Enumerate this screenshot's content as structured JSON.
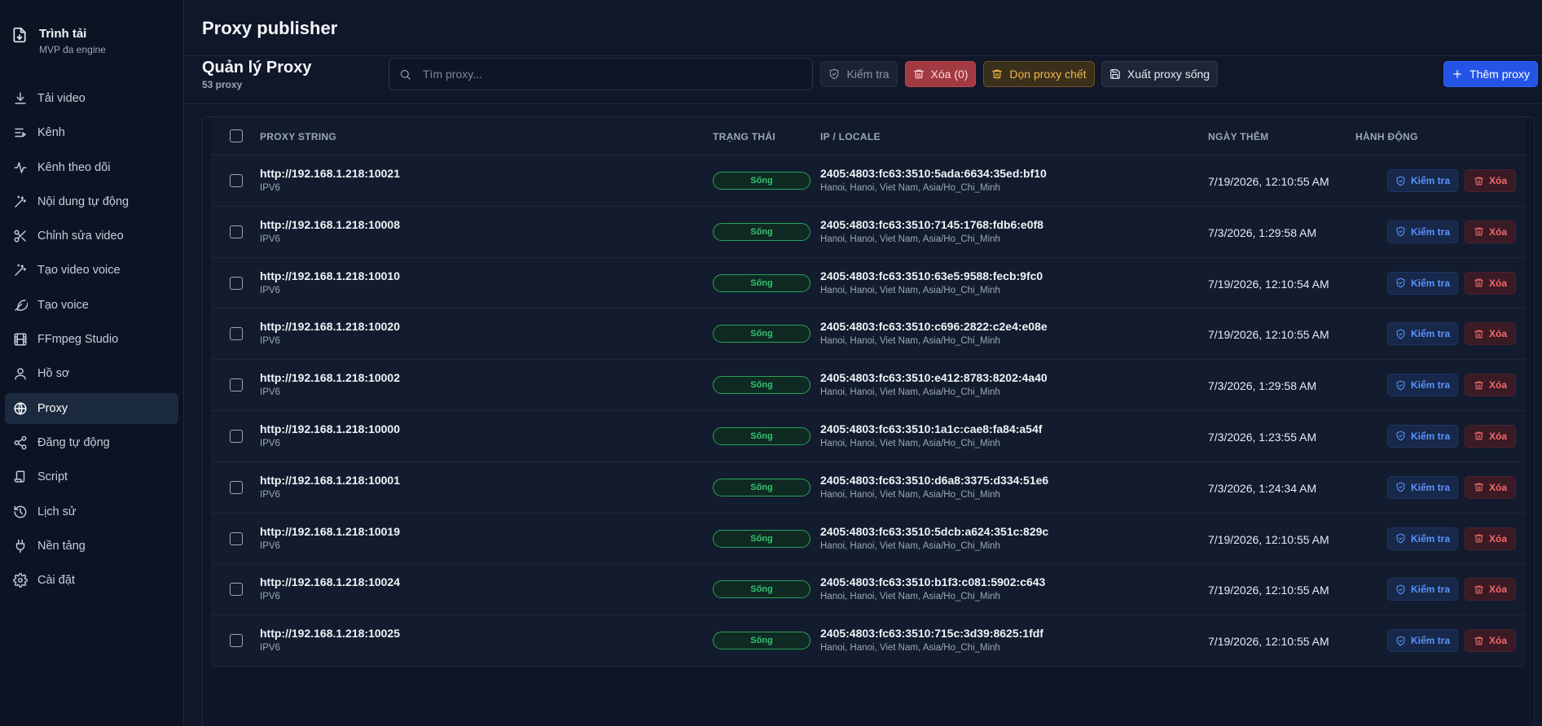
{
  "brand": {
    "title": "Trình tải",
    "subtitle": "MVP đa engine"
  },
  "sidebar": {
    "items": [
      {
        "label": "Tải video",
        "icon": "download-icon",
        "active": false
      },
      {
        "label": "Kênh",
        "icon": "channel-list-icon",
        "active": false
      },
      {
        "label": "Kênh theo dõi",
        "icon": "activity-icon",
        "active": false
      },
      {
        "label": "Nội dung tự động",
        "icon": "magic-wand-icon",
        "active": false
      },
      {
        "label": "Chỉnh sửa video",
        "icon": "scissors-icon",
        "active": false
      },
      {
        "label": "Tạo video voice",
        "icon": "magic-wand-icon",
        "active": false
      },
      {
        "label": "Tạo voice",
        "icon": "feather-icon",
        "active": false
      },
      {
        "label": "FFmpeg Studio",
        "icon": "film-icon",
        "active": false
      },
      {
        "label": "Hồ sơ",
        "icon": "user-icon",
        "active": false
      },
      {
        "label": "Proxy",
        "icon": "globe-icon",
        "active": true
      },
      {
        "label": "Đăng tự động",
        "icon": "share-icon",
        "active": false
      },
      {
        "label": "Script",
        "icon": "script-icon",
        "active": false
      },
      {
        "label": "Lịch sử",
        "icon": "history-icon",
        "active": false
      },
      {
        "label": "Nền tảng",
        "icon": "plug-icon",
        "active": false
      },
      {
        "label": "Cài đặt",
        "icon": "gear-icon",
        "active": false
      }
    ]
  },
  "header": {
    "title": "Proxy publisher"
  },
  "section": {
    "title": "Quản lý Proxy",
    "count": "53 proxy"
  },
  "search": {
    "placeholder": "Tìm proxy..."
  },
  "toolbar": {
    "check_label": "Kiểm tra",
    "delete_label": "Xóa (0)",
    "clean_label": "Dọn proxy chết",
    "export_label": "Xuất proxy sống",
    "add_label": "Thêm proxy"
  },
  "table": {
    "columns": [
      "PROXY STRING",
      "TRẠNG THÁI",
      "IP / LOCALE",
      "NGÀY THÊM",
      "HÀNH ĐỘNG"
    ],
    "row_check_label": "Kiểm tra",
    "row_delete_label": "Xóa",
    "rows": [
      {
        "proxy": "http://192.168.1.218:10021",
        "type": "IPV6",
        "status": "Sống",
        "ip": "2405:4803:fc63:3510:5ada:6634:35ed:bf10",
        "locale": "Hanoi, Hanoi, Viet Nam, Asia/Ho_Chi_Minh",
        "date": "7/19/2026, 12:10:55 AM"
      },
      {
        "proxy": "http://192.168.1.218:10008",
        "type": "IPV6",
        "status": "Sống",
        "ip": "2405:4803:fc63:3510:7145:1768:fdb6:e0f8",
        "locale": "Hanoi, Hanoi, Viet Nam, Asia/Ho_Chi_Minh",
        "date": "7/3/2026, 1:29:58 AM"
      },
      {
        "proxy": "http://192.168.1.218:10010",
        "type": "IPV6",
        "status": "Sống",
        "ip": "2405:4803:fc63:3510:63e5:9588:fecb:9fc0",
        "locale": "Hanoi, Hanoi, Viet Nam, Asia/Ho_Chi_Minh",
        "date": "7/19/2026, 12:10:54 AM"
      },
      {
        "proxy": "http://192.168.1.218:10020",
        "type": "IPV6",
        "status": "Sống",
        "ip": "2405:4803:fc63:3510:c696:2822:c2e4:e08e",
        "locale": "Hanoi, Hanoi, Viet Nam, Asia/Ho_Chi_Minh",
        "date": "7/19/2026, 12:10:55 AM"
      },
      {
        "proxy": "http://192.168.1.218:10002",
        "type": "IPV6",
        "status": "Sống",
        "ip": "2405:4803:fc63:3510:e412:8783:8202:4a40",
        "locale": "Hanoi, Hanoi, Viet Nam, Asia/Ho_Chi_Minh",
        "date": "7/3/2026, 1:29:58 AM"
      },
      {
        "proxy": "http://192.168.1.218:10000",
        "type": "IPV6",
        "status": "Sống",
        "ip": "2405:4803:fc63:3510:1a1c:cae8:fa84:a54f",
        "locale": "Hanoi, Hanoi, Viet Nam, Asia/Ho_Chi_Minh",
        "date": "7/3/2026, 1:23:55 AM"
      },
      {
        "proxy": "http://192.168.1.218:10001",
        "type": "IPV6",
        "status": "Sống",
        "ip": "2405:4803:fc63:3510:d6a8:3375:d334:51e6",
        "locale": "Hanoi, Hanoi, Viet Nam, Asia/Ho_Chi_Minh",
        "date": "7/3/2026, 1:24:34 AM"
      },
      {
        "proxy": "http://192.168.1.218:10019",
        "type": "IPV6",
        "status": "Sống",
        "ip": "2405:4803:fc63:3510:5dcb:a624:351c:829c",
        "locale": "Hanoi, Hanoi, Viet Nam, Asia/Ho_Chi_Minh",
        "date": "7/19/2026, 12:10:55 AM"
      },
      {
        "proxy": "http://192.168.1.218:10024",
        "type": "IPV6",
        "status": "Sống",
        "ip": "2405:4803:fc63:3510:b1f3:c081:5902:c643",
        "locale": "Hanoi, Hanoi, Viet Nam, Asia/Ho_Chi_Minh",
        "date": "7/19/2026, 12:10:55 AM"
      },
      {
        "proxy": "http://192.168.1.218:10025",
        "type": "IPV6",
        "status": "Sống",
        "ip": "2405:4803:fc63:3510:715c:3d39:8625:1fdf",
        "locale": "Hanoi, Hanoi, Viet Nam, Asia/Ho_Chi_Minh",
        "date": "7/19/2026, 12:10:55 AM"
      }
    ]
  },
  "colors": {
    "accent": "#2354e6",
    "danger": "#a33a41",
    "warning": "#f2b84b",
    "success": "#33c46f",
    "background": "#0f1729"
  }
}
